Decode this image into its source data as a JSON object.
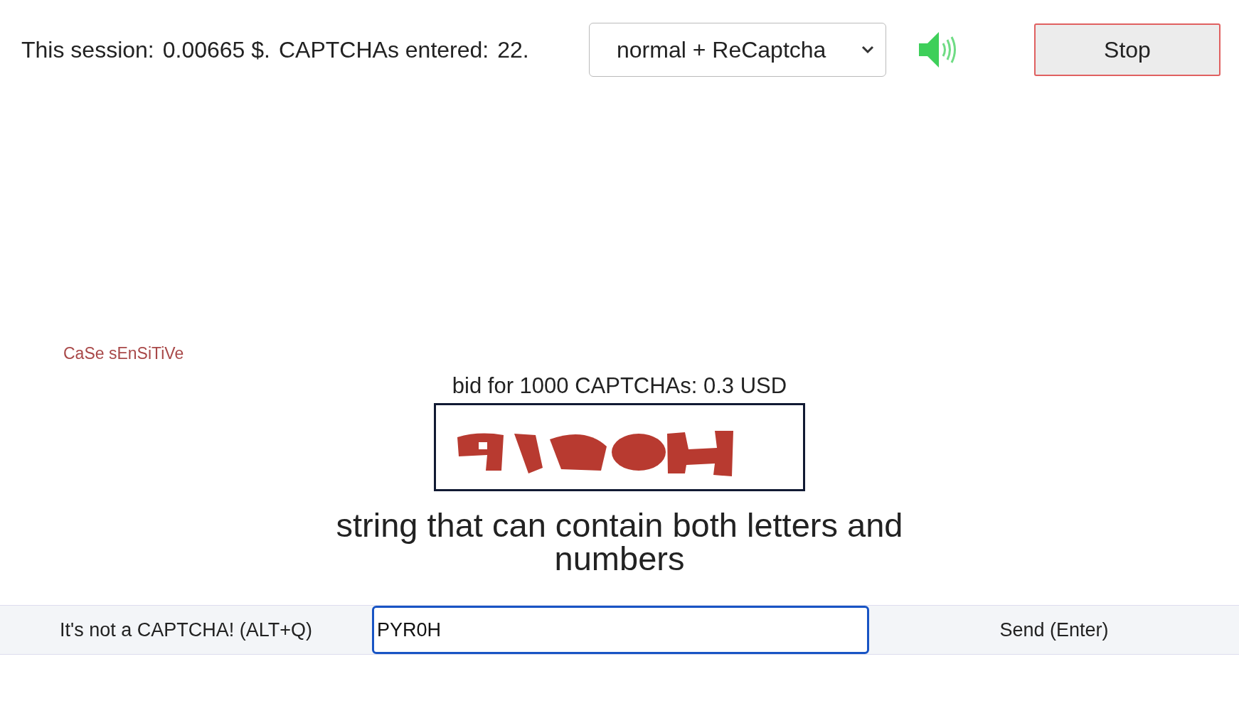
{
  "top_bar": {
    "session_label": "This session:",
    "session_amount": "0.00665 $.",
    "entered_label": "CAPTCHAs entered:",
    "entered_count": "22.",
    "mode_select": {
      "value": "normal + ReCaptcha"
    },
    "stop_button": "Stop"
  },
  "case_hint": "CaSe sEnSiTiVe",
  "bid": "bid for 1000 CAPTCHAs: 0.3 USD",
  "instruction": "string that can contain both letters and numbers",
  "answer_bar": {
    "not_captcha_button": "It's not a CAPTCHA! (ALT+Q)",
    "answer_field": {
      "value": "PYR0H"
    },
    "send_button": "Send (Enter)"
  }
}
